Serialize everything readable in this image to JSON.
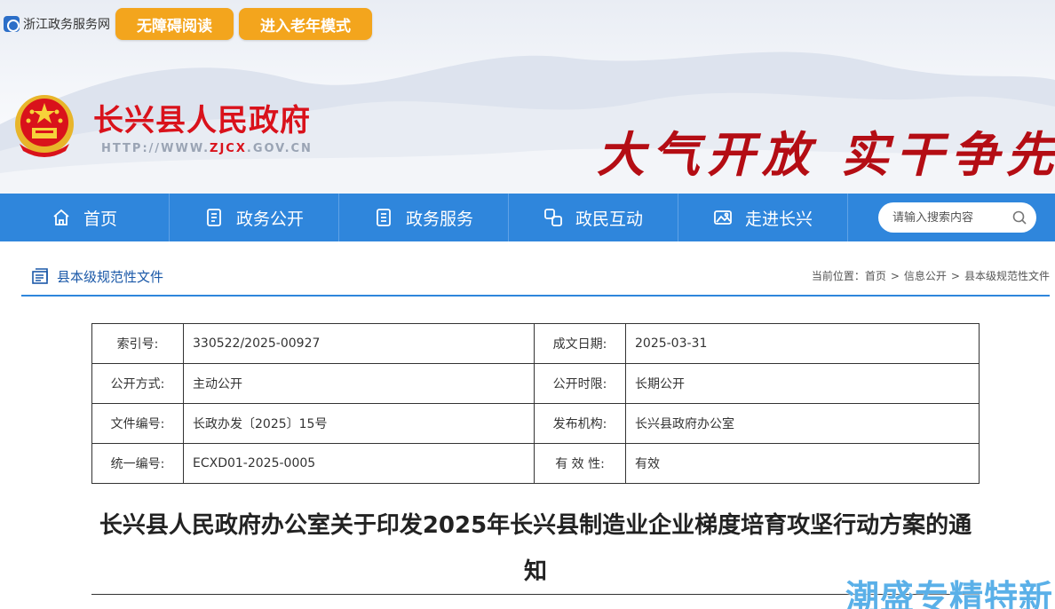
{
  "topbar": {
    "zj_link_label": "浙江政务服务网",
    "accessible_btn": "无障碍阅读",
    "elder_btn": "进入老年模式"
  },
  "header": {
    "site_title": "长兴县人民政府",
    "url_prefix": "HTTP://WWW.",
    "url_mid": "ZJCX",
    "url_suffix": ".GOV.CN",
    "slogan": "大气开放 实干争先"
  },
  "nav": {
    "items": [
      {
        "label": "首页",
        "icon": "home-icon"
      },
      {
        "label": "政务公开",
        "icon": "document-list-icon"
      },
      {
        "label": "政务服务",
        "icon": "service-icon"
      },
      {
        "label": "政民互动",
        "icon": "interaction-icon"
      },
      {
        "label": "走进长兴",
        "icon": "image-icon"
      }
    ],
    "search_placeholder": "请输入搜索内容"
  },
  "section": {
    "title": "县本级规范性文件",
    "breadcrumb_label": "当前位置：",
    "breadcrumb": [
      "首页",
      "信息公开",
      "县本级规范性文件"
    ]
  },
  "meta": {
    "rows": [
      {
        "k1": "索引号:",
        "v1": "330522/2025-00927",
        "k2": "成文日期:",
        "v2": "2025-03-31"
      },
      {
        "k1": "公开方式:",
        "v1": "主动公开",
        "k2": "公开时限:",
        "v2": "长期公开"
      },
      {
        "k1": "文件编号:",
        "v1": "长政办发〔2025〕15号",
        "k2": "发布机构:",
        "v2": "长兴县政府办公室"
      },
      {
        "k1": "统一编号:",
        "v1": "ECXD01-2025-0005",
        "k2": "有 效 性:",
        "v2": "有效"
      }
    ]
  },
  "document": {
    "title": "长兴县人民政府办公室关于印发2025年长兴县制造业企业梯度培育攻坚行动方案的通知"
  },
  "watermark": "潮盛专精特新",
  "colors": {
    "nav_blue": "#2f86dc",
    "button_orange": "#f3a51d",
    "title_red": "#d9121b"
  }
}
